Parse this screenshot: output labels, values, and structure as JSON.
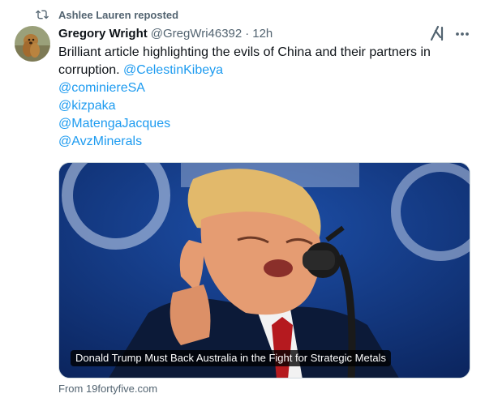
{
  "repost": {
    "icon": "repost-icon",
    "text": "Ashlee Lauren reposted"
  },
  "author": {
    "name": "Gregory Wright",
    "handle": "@GregWri46392",
    "separator": "·",
    "time": "12h"
  },
  "body": {
    "text": "Brilliant article highlighting the evils of China and their partners in corruption. ",
    "mentions": [
      "@CelestinKibeya",
      "@cominiereSA",
      "@kizpaka",
      "@MatengaJacques",
      "@AvzMinerals"
    ]
  },
  "card": {
    "caption": "Donald Trump Must Back Australia in the Fight for Strategic Metals",
    "source": "From 19fortyfive.com"
  },
  "colors": {
    "link": "#1d9bf0",
    "muted": "#536471",
    "text": "#0f1419"
  }
}
